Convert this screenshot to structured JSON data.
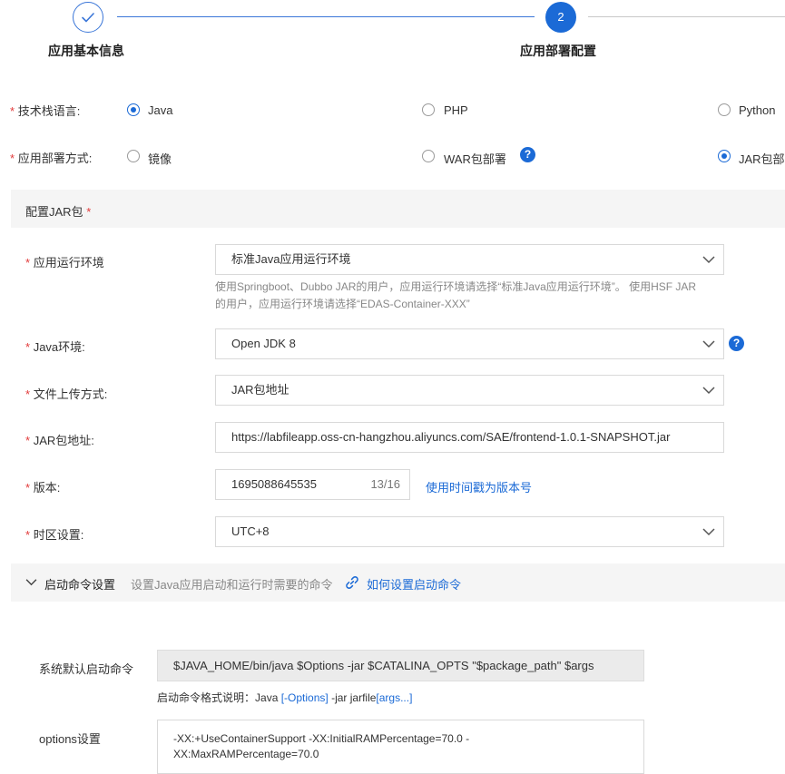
{
  "steps": [
    {
      "title": "应用基本信息",
      "state": "done"
    },
    {
      "number": "2",
      "title": "应用部署配置",
      "state": "active"
    }
  ],
  "tech_stack": {
    "label": "技术栈语言:",
    "options": [
      {
        "label": "Java",
        "selected": true
      },
      {
        "label": "PHP",
        "selected": false
      },
      {
        "label": "Python",
        "selected": false
      }
    ]
  },
  "deploy_method": {
    "label": "应用部署方式:",
    "options": [
      {
        "label": "镜像",
        "selected": false
      },
      {
        "label": "WAR包部署",
        "selected": false
      },
      {
        "label": "JAR包部署",
        "selected": true
      }
    ]
  },
  "jar_section": {
    "title": "配置JAR包",
    "runtime": {
      "label": "应用运行环境",
      "value": "标准Java应用运行环境",
      "hint_line1": "使用Springboot、Dubbo JAR的用户，应用运行环境请选择“标准Java应用运行环境”。 使用HSF JAR",
      "hint_line2": "的用户，应用运行环境请选择“EDAS-Container-XXX”"
    },
    "java_env": {
      "label": "Java环境:",
      "value": "Open JDK 8"
    },
    "upload": {
      "label": "文件上传方式:",
      "value": "JAR包地址"
    },
    "jar_url": {
      "label": "JAR包地址:",
      "value": "https://labfileapp.oss-cn-hangzhou.aliyuncs.com/SAE/frontend-1.0.1-SNAPSHOT.jar"
    },
    "version": {
      "label": "版本:",
      "value": "1695088645535",
      "counter": "13/16",
      "timestamp_link": "使用时间戳为版本号"
    },
    "timezone": {
      "label": "时区设置:",
      "value": "UTC+8"
    }
  },
  "startup": {
    "title": "启动命令设置",
    "description": "设置Java应用启动和运行时需要的命令",
    "help_link": "如何设置启动命令",
    "default_cmd_label": "系统默认启动命令",
    "default_cmd": "$JAVA_HOME/bin/java $Options -jar $CATALINA_OPTS \"$package_path\" $args",
    "format_prefix": "启动命令格式说明：",
    "format_java": "Java ",
    "format_options": "[-Options]",
    "format_jar": " -jar jarfile",
    "format_args": "[args...]",
    "options_label": "options设置",
    "options_line1": "-XX:+UseContainerSupport -XX:InitialRAMPercentage=70.0 -",
    "options_line2": "XX:MaxRAMPercentage=70.0"
  },
  "required_mark": "*",
  "help_mark": "?",
  "colors": {
    "accent": "#1b6ad6",
    "required": "#e23a3a"
  }
}
